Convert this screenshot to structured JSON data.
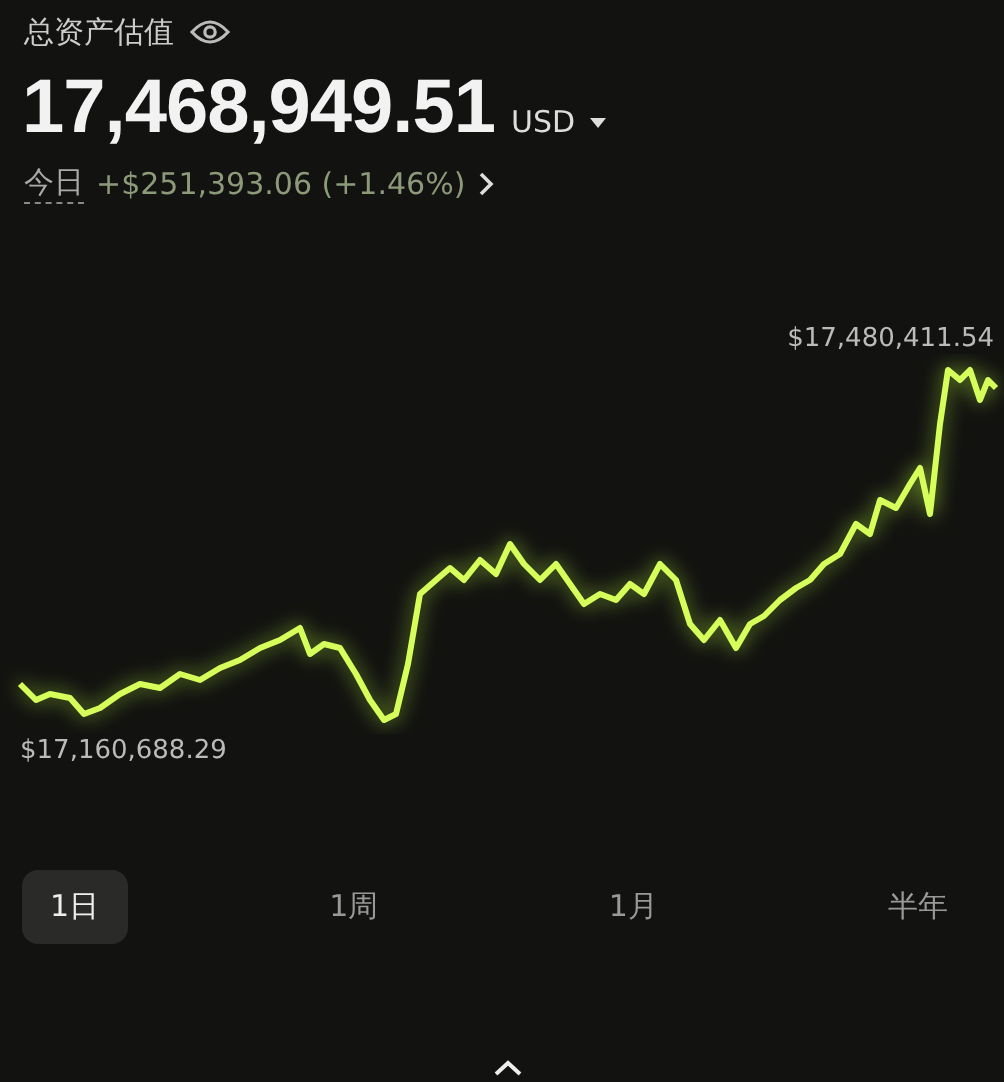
{
  "header": {
    "title": "总资产估值",
    "balance": "17,468,949.51",
    "currency": "USD",
    "today_label": "今日",
    "today_change": "+$251,393.06 (+1.46%)"
  },
  "chart": {
    "high_label": "$17,480,411.54",
    "low_label": "$17,160,688.29"
  },
  "ranges": [
    {
      "label": "1日",
      "selected": true
    },
    {
      "label": "1周",
      "selected": false
    },
    {
      "label": "1月",
      "selected": false
    },
    {
      "label": "半年",
      "selected": false
    }
  ]
}
